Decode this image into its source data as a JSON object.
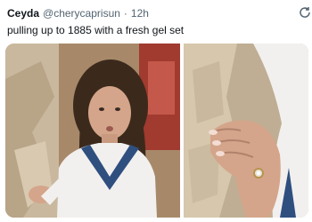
{
  "tweet": {
    "display_name": "Ceyda",
    "handle": "@cherycaprisun",
    "separator": "·",
    "time": "12h",
    "text": "pulling up to 1885 with a fresh gel set"
  },
  "media": [
    {
      "kind": "photo",
      "description_icon": "photo-left"
    },
    {
      "kind": "photo",
      "description_icon": "photo-right"
    }
  ],
  "colors": {
    "name": "#0f1419",
    "secondary": "#536471",
    "rock": "#c9b89e",
    "dress": "#f2f0ee",
    "collar": "#2f4f7f",
    "hair": "#3b2a1c",
    "skin": "#d4a58a"
  }
}
